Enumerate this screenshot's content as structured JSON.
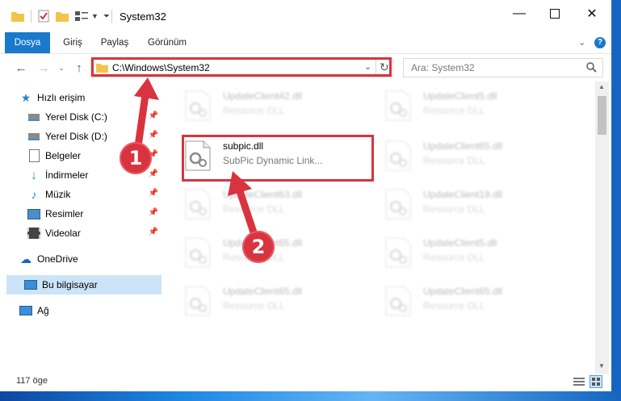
{
  "window": {
    "title": "System32"
  },
  "ribbon": {
    "tabs": [
      "Dosya",
      "Giriş",
      "Paylaş",
      "Görünüm"
    ]
  },
  "nav": {
    "path": "C:\\Windows\\System32",
    "search_placeholder": "Ara: System32"
  },
  "sidebar": {
    "items": [
      {
        "label": "Hızlı erişim",
        "icon": "star-icon"
      },
      {
        "label": "Yerel Disk (C:)",
        "icon": "drive-icon",
        "pinned": true
      },
      {
        "label": "Yerel Disk (D:)",
        "icon": "drive-icon",
        "pinned": true
      },
      {
        "label": "Belgeler",
        "icon": "document-icon",
        "pinned": true
      },
      {
        "label": "İndirmeler",
        "icon": "download-icon",
        "pinned": true
      },
      {
        "label": "Müzik",
        "icon": "music-icon",
        "pinned": true
      },
      {
        "label": "Resimler",
        "icon": "picture-icon",
        "pinned": true
      },
      {
        "label": "Videolar",
        "icon": "video-icon",
        "pinned": true
      },
      {
        "label": "OneDrive",
        "icon": "cloud-icon"
      },
      {
        "label": "Bu bilgisayar",
        "icon": "computer-icon",
        "selected": true
      },
      {
        "label": "Ağ",
        "icon": "network-icon"
      }
    ]
  },
  "files": [
    {
      "name": "UpdateClient42.dll",
      "desc": "Resource DLL"
    },
    {
      "name": "UpdateClient5.dll",
      "desc": "Resource DLL"
    },
    {
      "name": "subpic.dll",
      "desc": "SubPic Dynamic Link..."
    },
    {
      "name": "UpdateClient65.dll",
      "desc": "Resource DLL"
    },
    {
      "name": "UpdateClient63.dll",
      "desc": "Resource DLL"
    },
    {
      "name": "UpdateClient19.dll",
      "desc": "Resource DLL"
    },
    {
      "name": "UpdateClient65.dll",
      "desc": "Resource DLL"
    },
    {
      "name": "UpdateClient5.dll",
      "desc": "Resource DLL"
    },
    {
      "name": "UpdateClient65.dll",
      "desc": "Resource DLL"
    },
    {
      "name": "UpdateClient65.dll",
      "desc": "Resource DLL"
    }
  ],
  "status": {
    "count": "117 öge"
  },
  "annotations": {
    "step1": "1",
    "step2": "2"
  },
  "colors": {
    "accent": "#1979ca",
    "highlight": "#d9333f",
    "selection": "#cce4f7"
  }
}
